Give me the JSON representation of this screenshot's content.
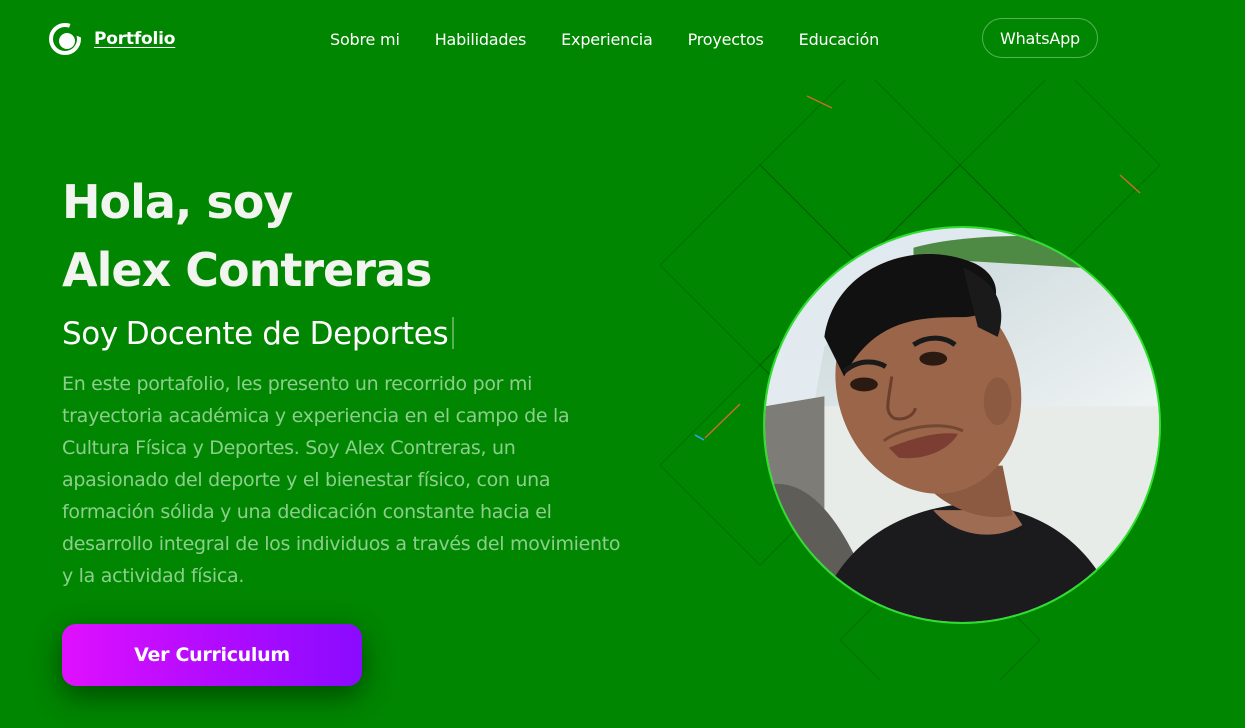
{
  "header": {
    "logo_text": "Portfolio",
    "nav": [
      "Sobre mi",
      "Habilidades",
      "Experiencia",
      "Proyectos",
      "Educación"
    ],
    "whatsapp_label": "WhatsApp"
  },
  "hero": {
    "title_line1": "Hola, soy",
    "title_line2": "Alex Contreras",
    "subtitle_prefix": "Soy",
    "subtitle_role": "Docente de Deportes",
    "description": "En este portafolio, les presento un recorrido por mi trayectoria académica y experiencia en el campo de la Cultura Física y Deportes. Soy Alex Contreras, un apasionado del deporte y el bienestar físico, con una formación sólida y una dedicación constante hacia el desarrollo integral de los individuos a través del movimiento y la actividad física.",
    "cta_label": "Ver Curriculum"
  },
  "colors": {
    "background": "#018601",
    "description_text": "#8ccf8c",
    "cta_gradient_start": "#e010ff",
    "cta_gradient_end": "#8a0bff",
    "profile_border": "#2ee02e"
  },
  "icons": {
    "logo": "ring-logo-icon"
  }
}
